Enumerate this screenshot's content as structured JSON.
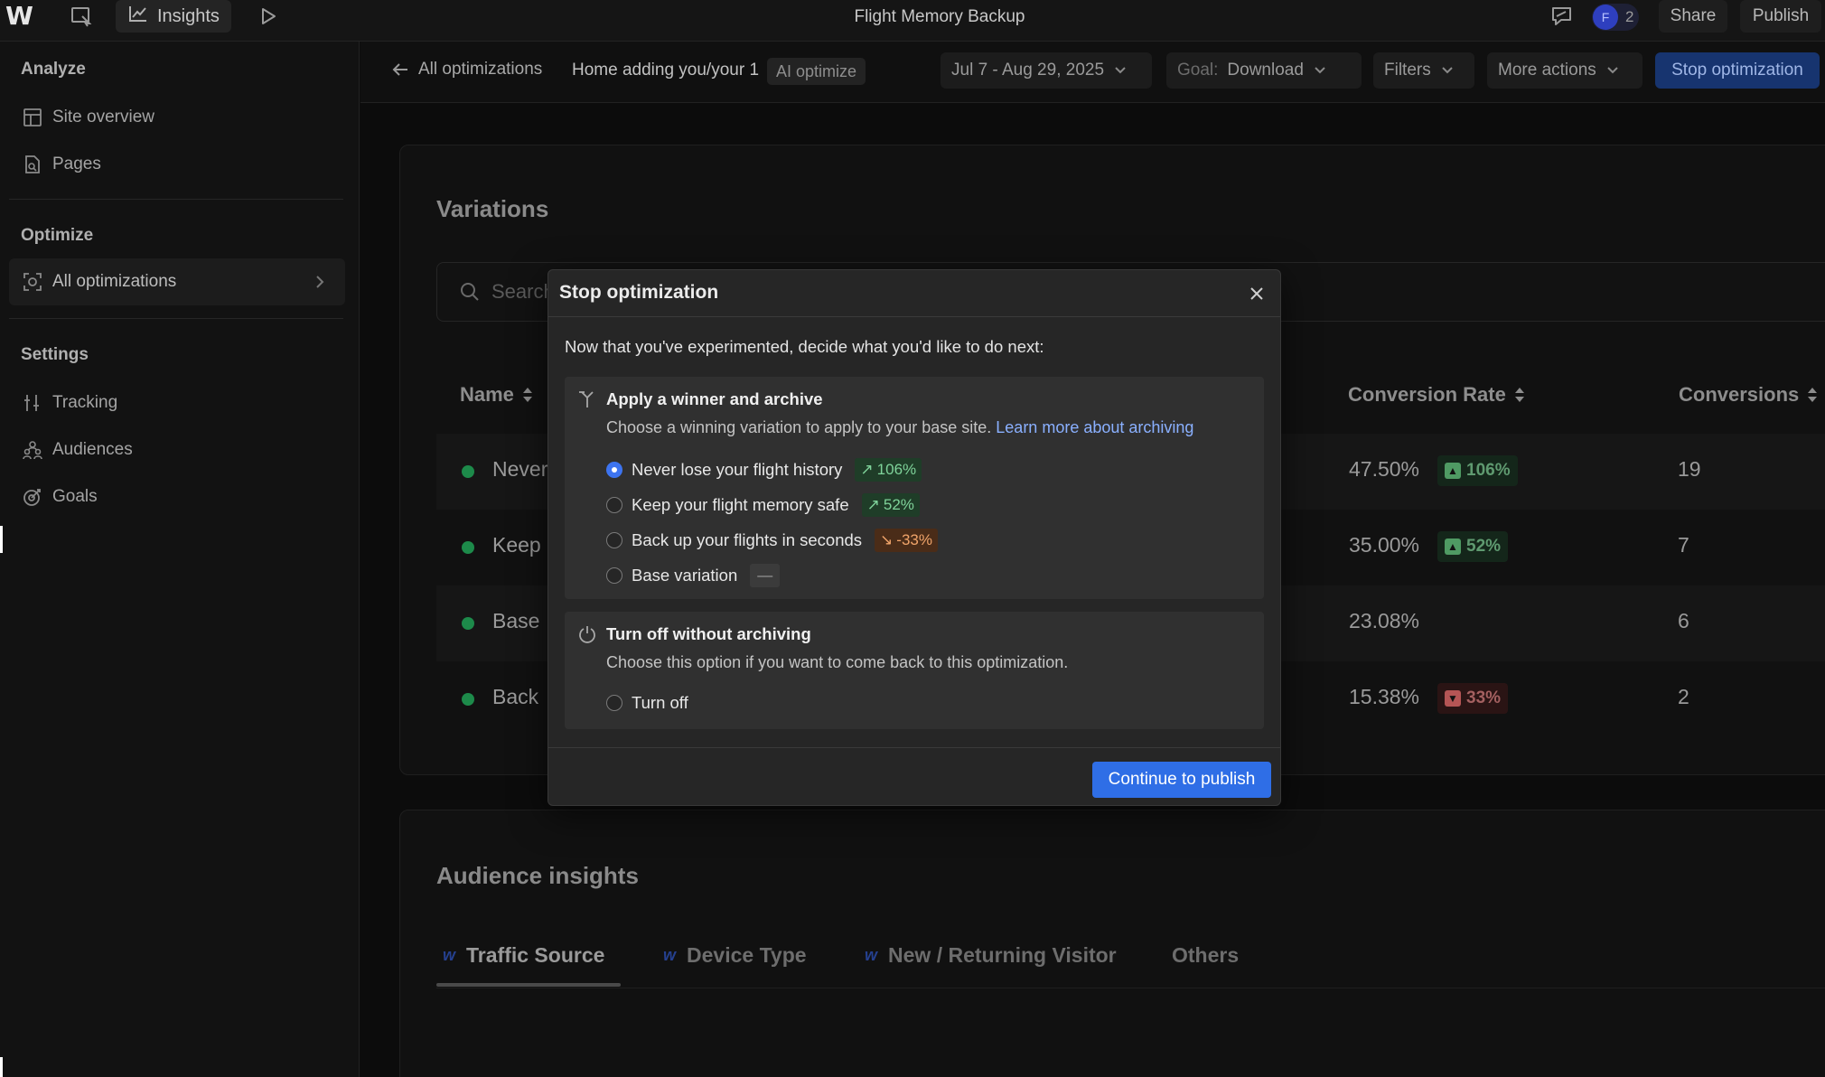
{
  "topbar": {
    "logo": "W",
    "insights_label": "Insights",
    "title": "Flight Memory Backup",
    "avatar_initial": "F",
    "avatar_count": "2",
    "share_label": "Share",
    "publish_label": "Publish"
  },
  "sidebar": {
    "analyze_heading": "Analyze",
    "site_overview": "Site overview",
    "pages": "Pages",
    "optimize_heading": "Optimize",
    "all_optimizations": "All optimizations",
    "settings_heading": "Settings",
    "tracking": "Tracking",
    "audiences": "Audiences",
    "goals": "Goals"
  },
  "subheader": {
    "back_label": "All optimizations",
    "crumb": "Home adding you/your 1",
    "badge": "AI optimize",
    "date_range": "Jul 7 - Aug 29, 2025",
    "goal_prefix": "Goal:",
    "goal_value": "Download",
    "filters": "Filters",
    "more_actions": "More actions",
    "stop_optimization": "Stop optimization"
  },
  "variations": {
    "title": "Variations",
    "search_placeholder": "Search",
    "columns": {
      "name": "Name",
      "conversion_rate": "Conversion Rate",
      "conversions": "Conversions"
    },
    "rows": [
      {
        "name": "Never",
        "rate": "47.50%",
        "change": "106%",
        "direction": "up",
        "conversions": "19"
      },
      {
        "name": "Keep",
        "rate": "35.00%",
        "change": "52%",
        "direction": "up",
        "conversions": "7"
      },
      {
        "name": "Base",
        "rate": "23.08%",
        "change": "",
        "direction": "none",
        "conversions": "6"
      },
      {
        "name": "Back",
        "rate": "15.38%",
        "change": "33%",
        "direction": "down",
        "conversions": "2"
      }
    ]
  },
  "audience": {
    "title": "Audience insights",
    "tabs": [
      "Traffic Source",
      "Device Type",
      "New / Returning Visitor",
      "Others"
    ]
  },
  "modal": {
    "title": "Stop optimization",
    "intro": "Now that you've experimented, decide what you'd like to do next:",
    "apply": {
      "heading": "Apply a winner and archive",
      "desc": "Choose a winning variation to apply to your base site.",
      "link": "Learn more about archiving",
      "options": [
        {
          "label": "Never lose your flight history",
          "badge": "106%",
          "kind": "up",
          "checked": true
        },
        {
          "label": "Keep your flight memory safe",
          "badge": "52%",
          "kind": "up",
          "checked": false
        },
        {
          "label": "Back up your flights in seconds",
          "badge": "-33%",
          "kind": "down",
          "checked": false
        },
        {
          "label": "Base variation",
          "badge": "—",
          "kind": "neutral",
          "checked": false
        }
      ]
    },
    "turnoff": {
      "heading": "Turn off without archiving",
      "desc": "Choose this option if you want to come back to this optimization.",
      "option": "Turn off"
    },
    "continue_label": "Continue to publish"
  }
}
